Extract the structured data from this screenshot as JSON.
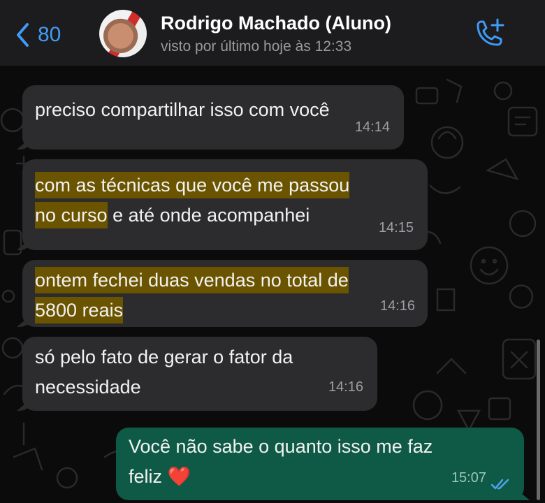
{
  "header": {
    "back_count": "80",
    "contact_name": "Rodrigo Machado (Aluno)",
    "last_seen": "visto por último hoje às 12:33"
  },
  "messages": [
    {
      "direction": "incoming",
      "text": "preciso compartilhar isso com você",
      "time": "14:14"
    },
    {
      "direction": "incoming",
      "highlight": "com as técnicas que você me passou",
      "highlight_2": "no curso",
      "rest": " e até onde acompanhei",
      "time": "14:15"
    },
    {
      "direction": "incoming",
      "highlight": "ontem fechei duas vendas no total de",
      "highlight_2": "5800 reais",
      "time": "14:16"
    },
    {
      "direction": "incoming",
      "line1": "só pelo fato de gerar o fator da",
      "line2": "necessidade",
      "time": "14:16"
    },
    {
      "direction": "outgoing",
      "line1": "Você não sabe o quanto isso me faz",
      "line2": "feliz",
      "emoji": "❤️",
      "time": "15:07",
      "status": "read"
    }
  ],
  "colors": {
    "accent": "#3f9bf5",
    "incoming_bubble": "#2c2c2e",
    "outgoing_bubble": "#0f5a46",
    "highlight": "#6b5400"
  },
  "icons": [
    "back-chevron-icon",
    "add-call-icon",
    "read-receipt-icon",
    "heart-emoji-icon"
  ]
}
